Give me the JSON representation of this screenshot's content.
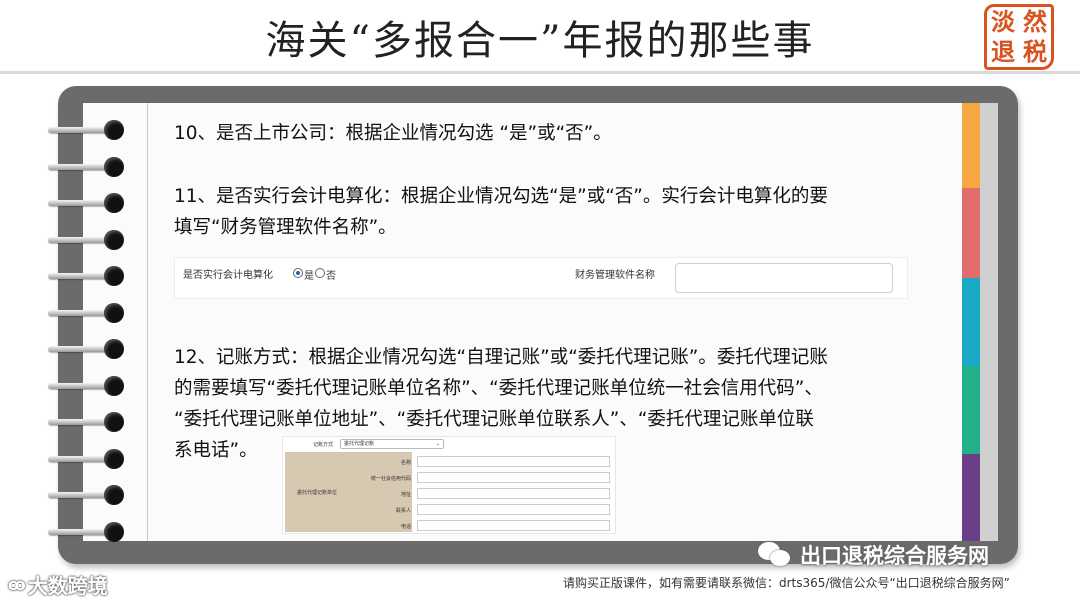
{
  "header": {
    "title": "海关“多报合一”年报的那些事",
    "logo_chars": [
      "淡",
      "然",
      "退",
      "税"
    ]
  },
  "content": {
    "item10": "10、是否上市公司：根据企业情况勾选 “是”或“否”。",
    "item11_line1": "11、是否实行会计电算化：根据企业情况勾选“是”或“否”。实行会计电算化的要",
    "item11_line2": "填写“财务管理软件名称”。",
    "item12_line1": "12、记账方式：根据企业情况勾选“自理记账”或“委托代理记账”。委托代理记账",
    "item12_line2": "的需要填写“委托代理记账单位名称”、“委托代理记账单位统一社会信用代码”、",
    "item12_line3": "“委托代理记账单位地址”、“委托代理记账单位联系人”、“委托代理记账单位联",
    "item12_line4": "系电话”。"
  },
  "form1": {
    "label_computerized": "是否实行会计电算化",
    "option_yes": "是",
    "option_no": "否",
    "selected": "是",
    "label_software": "财务管理软件名称",
    "software_value": ""
  },
  "form2": {
    "label_method": "记账方式",
    "method_value": "委托代理记账",
    "group_label": "委托代理记账单位",
    "rows": [
      "名称",
      "统一社会信用代码",
      "地址",
      "联系人",
      "电话"
    ]
  },
  "watermarks": {
    "right": "出口退税综合服务网",
    "left": "大数跨境"
  },
  "footer": {
    "text": "请购买正版课件，如有需要请联系微信：drts365/微信公众号“出口退税综合服务网”"
  },
  "colors": {
    "tabs": [
      "#f5a742",
      "#e36c6c",
      "#1aa9c4",
      "#22b08a",
      "#6b3f87"
    ],
    "logo": "#d9531e"
  }
}
